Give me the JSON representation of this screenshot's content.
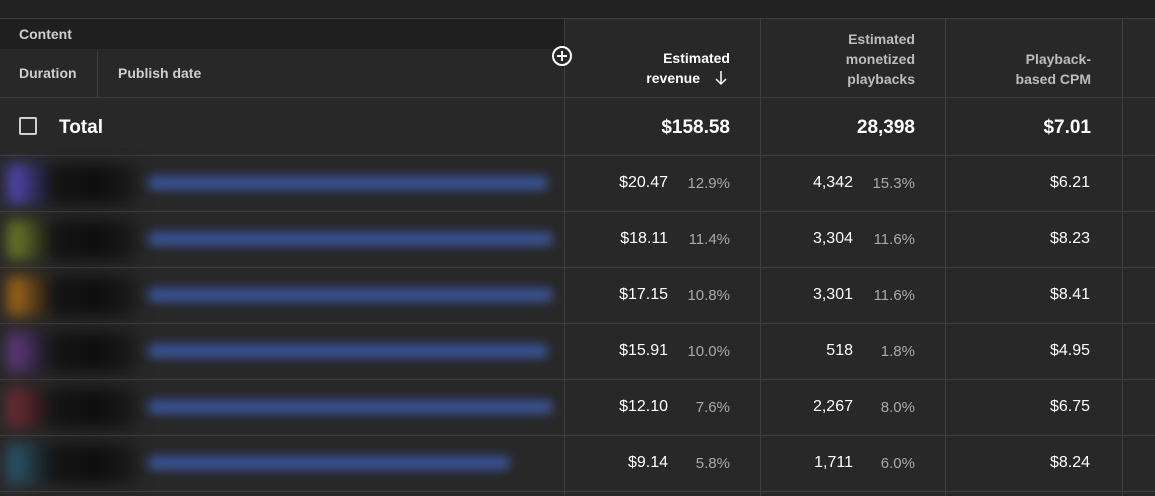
{
  "header": {
    "content_label": "Content",
    "duration_label": "Duration",
    "publish_date_label": "Publish date",
    "columns": [
      {
        "label_lines": [
          "Estimated",
          "revenue"
        ],
        "sorted": true,
        "sort_icon": "arrow-down-icon"
      },
      {
        "label_lines": [
          "Estimated",
          "monetized",
          "playbacks"
        ],
        "sorted": false
      },
      {
        "label_lines": [
          "Playback-",
          "based CPM"
        ],
        "sorted": false
      }
    ],
    "add_column_icon": "plus-circle-icon"
  },
  "total": {
    "label": "Total",
    "revenue": "$158.58",
    "playbacks": "28,398",
    "cpm": "$7.01"
  },
  "rows": [
    {
      "revenue": "$20.47",
      "revenue_pct": "12.9%",
      "playbacks": "4,342",
      "playbacks_pct": "15.3%",
      "cpm": "$6.21",
      "thumb_color": "#5b4fc9"
    },
    {
      "revenue": "$18.11",
      "revenue_pct": "11.4%",
      "playbacks": "3,304",
      "playbacks_pct": "11.6%",
      "cpm": "$8.23",
      "thumb_color": "#7a8a2a"
    },
    {
      "revenue": "$17.15",
      "revenue_pct": "10.8%",
      "playbacks": "3,301",
      "playbacks_pct": "11.6%",
      "cpm": "$8.41",
      "thumb_color": "#b8741a"
    },
    {
      "revenue": "$15.91",
      "revenue_pct": "10.0%",
      "playbacks": "518",
      "playbacks_pct": "1.8%",
      "cpm": "$4.95",
      "thumb_color": "#6a3f8c"
    },
    {
      "revenue": "$12.10",
      "revenue_pct": "7.6%",
      "playbacks": "2,267",
      "playbacks_pct": "8.0%",
      "cpm": "$6.75",
      "thumb_color": "#7a2f3a"
    },
    {
      "revenue": "$9.14",
      "revenue_pct": "5.8%",
      "playbacks": "1,711",
      "playbacks_pct": "6.0%",
      "cpm": "$8.24",
      "thumb_color": "#2f5f7a"
    }
  ],
  "colors": {
    "background": "#282828",
    "header_band": "#212121",
    "divider": "#3e3e3e",
    "text_primary": "#ffffff",
    "text_secondary": "#aaaaaa"
  }
}
